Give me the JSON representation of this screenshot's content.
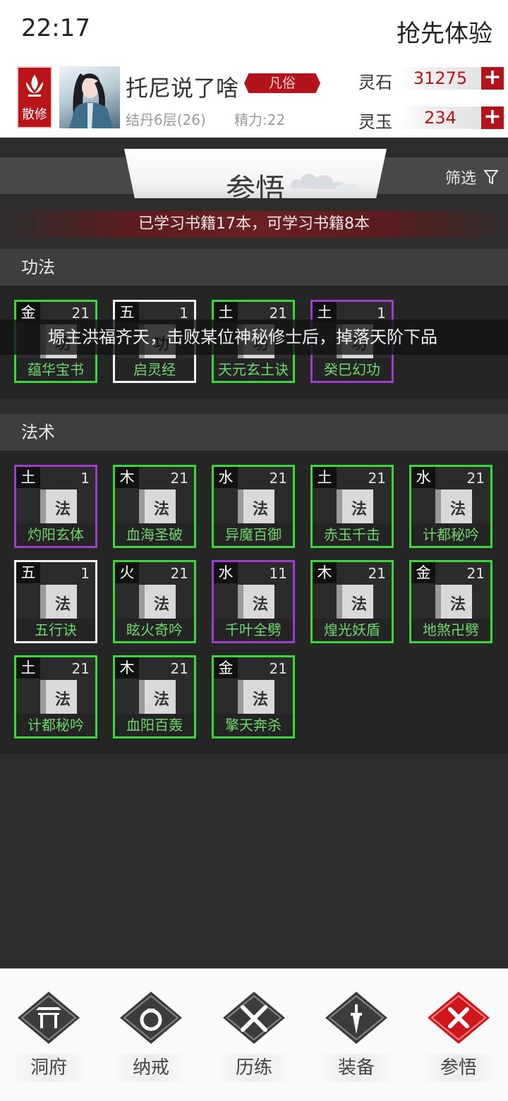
{
  "status_bar": {
    "time": "22:17",
    "right_text": "抢先体验"
  },
  "profile": {
    "sect_label": "散修",
    "name": "托尼说了啥",
    "rank": "凡俗",
    "realm": "结丹6层(26)",
    "energy": "精力:22",
    "resources": [
      {
        "label": "灵石",
        "value": "31275",
        "add": "+"
      },
      {
        "label": "灵玉",
        "value": "234",
        "add": "+"
      }
    ]
  },
  "header": {
    "title": "参悟",
    "filter_label": "筛选",
    "filter_icon": "filter-icon"
  },
  "study_summary": "已学习书籍17本，可学习书籍8本",
  "marquee_text": "塬主洪福齐天，击败某位神秘修士后，掉落天阶下品",
  "sections": [
    {
      "title": "功法",
      "cards": [
        {
          "element": "金",
          "level": "21",
          "glyph": "功",
          "name": "蕴华宝书",
          "quality": "green"
        },
        {
          "element": "五",
          "level": "1",
          "glyph": "功",
          "name": "启灵经",
          "quality": "white"
        },
        {
          "element": "土",
          "level": "21",
          "glyph": "功",
          "name": "天元玄土诀",
          "quality": "green"
        },
        {
          "element": "土",
          "level": "1",
          "glyph": "功",
          "name": "癸巳幻功",
          "quality": "purple"
        }
      ]
    },
    {
      "title": "法术",
      "cards": [
        {
          "element": "土",
          "level": "1",
          "glyph": "法",
          "name": "灼阳玄体",
          "quality": "purple"
        },
        {
          "element": "木",
          "level": "21",
          "glyph": "法",
          "name": "血海圣破",
          "quality": "green"
        },
        {
          "element": "水",
          "level": "21",
          "glyph": "法",
          "name": "异魔百御",
          "quality": "green"
        },
        {
          "element": "土",
          "level": "21",
          "glyph": "法",
          "name": "赤玉千击",
          "quality": "green"
        },
        {
          "element": "水",
          "level": "21",
          "glyph": "法",
          "name": "计都秘吟",
          "quality": "green"
        },
        {
          "element": "五",
          "level": "1",
          "glyph": "法",
          "name": "五行诀",
          "quality": "white"
        },
        {
          "element": "火",
          "level": "21",
          "glyph": "法",
          "name": "眩火奇吟",
          "quality": "green"
        },
        {
          "element": "水",
          "level": "11",
          "glyph": "法",
          "name": "千叶全劈",
          "quality": "purple"
        },
        {
          "element": "木",
          "level": "21",
          "glyph": "法",
          "name": "煌光妖盾",
          "quality": "green"
        },
        {
          "element": "金",
          "level": "21",
          "glyph": "法",
          "name": "地煞卍劈",
          "quality": "green"
        },
        {
          "element": "土",
          "level": "21",
          "glyph": "法",
          "name": "计都秘吟",
          "quality": "green"
        },
        {
          "element": "木",
          "level": "21",
          "glyph": "法",
          "name": "血阳百轰",
          "quality": "green"
        },
        {
          "element": "金",
          "level": "21",
          "glyph": "法",
          "name": "擎天奔杀",
          "quality": "green"
        }
      ]
    }
  ],
  "bottom_nav": [
    {
      "label": "洞府",
      "icon": "gate-icon",
      "active": false
    },
    {
      "label": "纳戒",
      "icon": "ring-icon",
      "active": false
    },
    {
      "label": "历练",
      "icon": "crossed-swords-icon",
      "active": false
    },
    {
      "label": "装备",
      "icon": "dagger-icon",
      "active": false
    },
    {
      "label": "参悟",
      "icon": "close-x-icon",
      "active": true
    }
  ],
  "colors": {
    "accent_red": "#b3141b",
    "quality_green": "#3dd43d",
    "quality_white": "#f2f2f2",
    "quality_purple": "#9b3ec9",
    "card_name_green": "#71d66d"
  }
}
